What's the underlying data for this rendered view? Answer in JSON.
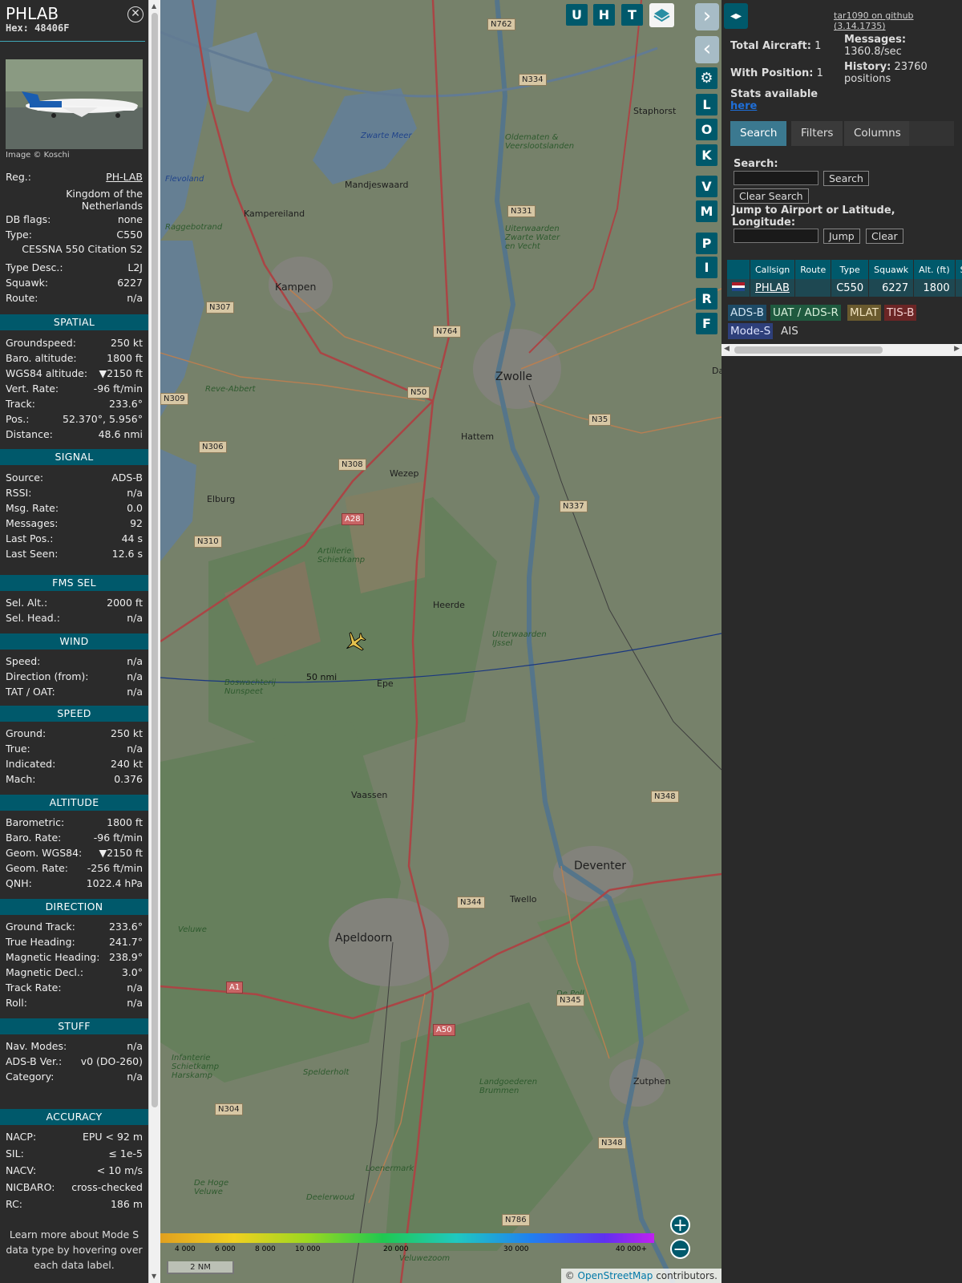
{
  "info": {
    "callsign": "PHLAB",
    "hex": "Hex: 48406F",
    "photo_credit": "Image © Koschi",
    "rows_top": [
      {
        "k": "Reg.:",
        "v": "PH-LAB"
      },
      {
        "k": "",
        "v": "Kingdom of the Netherlands"
      },
      {
        "k": "DB flags:",
        "v": "none"
      },
      {
        "k": "Type:",
        "v": "C550"
      },
      {
        "k": "",
        "v": "CESSNA 550 Citation S2"
      },
      {
        "k": "Type Desc.:",
        "v": "L2J"
      },
      {
        "k": "Squawk:",
        "v": "6227"
      },
      {
        "k": "Route:",
        "v": "n/a"
      }
    ],
    "sections": [
      {
        "title": "SPATIAL",
        "rows": [
          {
            "k": "Groundspeed:",
            "v": "250 kt"
          },
          {
            "k": "Baro. altitude:",
            "v": "1800 ft"
          },
          {
            "k": "WGS84 altitude:",
            "v": "▼2150 ft"
          },
          {
            "k": "Vert. Rate:",
            "v": "-96 ft/min"
          },
          {
            "k": "Track:",
            "v": "233.6°"
          },
          {
            "k": "Pos.:",
            "v": "52.370°, 5.956°"
          },
          {
            "k": "Distance:",
            "v": "48.6 nmi"
          }
        ]
      },
      {
        "title": "SIGNAL",
        "rows": [
          {
            "k": "Source:",
            "v": "ADS-B"
          },
          {
            "k": "RSSI:",
            "v": "n/a"
          },
          {
            "k": "Msg. Rate:",
            "v": "0.0"
          },
          {
            "k": "Messages:",
            "v": "92"
          },
          {
            "k": "Last Pos.:",
            "v": "44 s"
          },
          {
            "k": "Last Seen:",
            "v": "12.6 s"
          }
        ]
      },
      {
        "title": "FMS SEL",
        "rows": [
          {
            "k": "Sel. Alt.:",
            "v": "2000 ft"
          },
          {
            "k": "Sel. Head.:",
            "v": "n/a"
          }
        ]
      },
      {
        "title": "WIND",
        "rows": [
          {
            "k": "Speed:",
            "v": "n/a"
          },
          {
            "k": "Direction (from):",
            "v": "n/a"
          },
          {
            "k": "TAT / OAT:",
            "v": "n/a"
          }
        ]
      },
      {
        "title": "SPEED",
        "rows": [
          {
            "k": "Ground:",
            "v": "250 kt"
          },
          {
            "k": "True:",
            "v": "n/a"
          },
          {
            "k": "Indicated:",
            "v": "240 kt"
          },
          {
            "k": "Mach:",
            "v": "0.376"
          }
        ]
      },
      {
        "title": "ALTITUDE",
        "rows": [
          {
            "k": "Barometric:",
            "v": "1800 ft"
          },
          {
            "k": "Baro. Rate:",
            "v": "-96 ft/min"
          },
          {
            "k": "Geom. WGS84:",
            "v": "▼2150 ft"
          },
          {
            "k": "Geom. Rate:",
            "v": "-256 ft/min"
          },
          {
            "k": "QNH:",
            "v": "1022.4 hPa"
          }
        ]
      },
      {
        "title": "DIRECTION",
        "rows": [
          {
            "k": "Ground Track:",
            "v": "233.6°"
          },
          {
            "k": "True Heading:",
            "v": "241.7°"
          },
          {
            "k": "Magnetic Heading:",
            "v": "238.9°"
          },
          {
            "k": "Magnetic Decl.:",
            "v": "3.0°"
          },
          {
            "k": "Track Rate:",
            "v": "n/a"
          },
          {
            "k": "Roll:",
            "v": "n/a"
          }
        ]
      },
      {
        "title": "STUFF",
        "rows": [
          {
            "k": "Nav. Modes:",
            "v": "n/a"
          },
          {
            "k": "ADS-B Ver.:",
            "v": "v0 (DO-260)"
          },
          {
            "k": "Category:",
            "v": "n/a"
          }
        ]
      },
      {
        "title": "ACCURACY",
        "rows": [
          {
            "k": "NACP:",
            "v": "EPU < 92 m"
          },
          {
            "k": "SIL:",
            "v": "≤ 1e-5"
          },
          {
            "k": "NACV:",
            "v": "< 10 m/s"
          },
          {
            "k": "NICBARO:",
            "v": "cross-checked"
          },
          {
            "k": "RC:",
            "v": "186 m"
          }
        ]
      }
    ],
    "footer": "Learn more about Mode S data type by hovering over each data label."
  },
  "map": {
    "buttons_top": [
      "U",
      "H",
      "T"
    ],
    "side_buttons": [
      "L",
      "O",
      "K",
      "V",
      "M",
      "P",
      "I",
      "R",
      "F"
    ],
    "range_label": "50 nmi",
    "scale_label": "2 NM",
    "attribution_prefix": "© ",
    "attribution_link": "OpenStreetMap",
    "attribution_suffix": " contributors.",
    "alt_ticks": [
      "4 000",
      "6 000",
      "8 000",
      "10 000",
      "20 000",
      "30 000",
      "40 000+"
    ],
    "places": [
      {
        "name": "Zwolle",
        "cls": "big"
      },
      {
        "name": "Deventer",
        "cls": "big"
      },
      {
        "name": "Apeldoorn",
        "cls": "big"
      },
      {
        "name": "Kampen",
        "cls": "mid"
      },
      {
        "name": "Hattem",
        "cls": ""
      },
      {
        "name": "Wezep",
        "cls": ""
      },
      {
        "name": "Heerde",
        "cls": ""
      },
      {
        "name": "Epe",
        "cls": ""
      },
      {
        "name": "Vaassen",
        "cls": ""
      },
      {
        "name": "Twello",
        "cls": ""
      },
      {
        "name": "Zutphen",
        "cls": ""
      },
      {
        "name": "Elburg",
        "cls": ""
      },
      {
        "name": "Staphorst",
        "cls": ""
      },
      {
        "name": "Dalfsen",
        "cls": ""
      },
      {
        "name": "Kampereiland",
        "cls": ""
      },
      {
        "name": "Mandjeswaard",
        "cls": ""
      },
      {
        "name": "Veluwe",
        "cls": "nat"
      },
      {
        "name": "Artillerie Schietkamp",
        "cls": "nat"
      },
      {
        "name": "Reve-Abbert",
        "cls": "nat"
      },
      {
        "name": "Raggebotrand",
        "cls": "nat"
      },
      {
        "name": "Oldematen & Veerslootslanden",
        "cls": "nat"
      },
      {
        "name": "Uiterwaarden Zwarte Water en Vecht",
        "cls": "nat"
      },
      {
        "name": "Uiterwaarden IJssel",
        "cls": "nat"
      },
      {
        "name": "Boswachterij Nunspeet",
        "cls": "nat"
      },
      {
        "name": "Infanterie Schietkamp Harskamp",
        "cls": "nat"
      },
      {
        "name": "Spelderholt",
        "cls": "nat"
      },
      {
        "name": "Landgoederen Brummen",
        "cls": "nat"
      },
      {
        "name": "Loenermark",
        "cls": "nat"
      },
      {
        "name": "De Hoge Veluwe",
        "cls": "nat"
      },
      {
        "name": "Deelerwoud",
        "cls": "nat"
      },
      {
        "name": "Veluwezoom",
        "cls": "nat"
      },
      {
        "name": "De Poll",
        "cls": "nat"
      },
      {
        "name": "Zwarte Meer",
        "cls": "water"
      },
      {
        "name": "Flevoland",
        "cls": "water"
      }
    ],
    "shields": [
      "N762",
      "N334",
      "N331",
      "N307",
      "N764",
      "N50",
      "N35",
      "N309",
      "N306",
      "N308",
      "A28",
      "N337",
      "N310",
      "N348",
      "N344",
      "N345",
      "A50",
      "A1",
      "N304",
      "N786",
      "N348"
    ]
  },
  "sidebar": {
    "gh_link": "tar1090 on github (3.14.1735)",
    "total_label": "Total Aircraft:",
    "total_value": "1",
    "withpos_label": "With Position:",
    "withpos_value": "1",
    "stats_label": "Stats available",
    "stats_link": "here",
    "messages_label": "Messages:",
    "messages_value": "1360.8/sec",
    "history_label": "History:",
    "history_value": "23760 positions",
    "tabs": [
      "Search",
      "Filters",
      "Columns"
    ],
    "search_label": "Search:",
    "search_button": "Search",
    "clear_search_button": "Clear Search",
    "jump_label": "Jump to Airport or Latitude, Longitude:",
    "jump_button": "Jump",
    "clear_button": "Clear",
    "table_headers": [
      "",
      "Callsign",
      "Route",
      "Type",
      "Squawk",
      "Alt. (ft)",
      "Spd."
    ],
    "table_row": [
      "",
      "PHLAB",
      "",
      "C550",
      "6227",
      "1800",
      ""
    ],
    "legend": [
      {
        "label": "ADS-B",
        "bg": "#1d4a66",
        "fg": "#cfe3f2"
      },
      {
        "label": "UAT / ADS-R",
        "bg": "#1f5a3f",
        "fg": "#d6efd9"
      },
      {
        "label": "MLAT",
        "bg": "#6a5a2e",
        "fg": "#f2e4c0"
      },
      {
        "label": "TIS-B",
        "bg": "#6b2525",
        "fg": "#f4d0d0"
      },
      {
        "label": "Mode-S",
        "bg": "#2e3f7a",
        "fg": "#dde3ff"
      },
      {
        "label": "AIS",
        "bg": "transparent",
        "fg": "#dddddd"
      }
    ]
  }
}
